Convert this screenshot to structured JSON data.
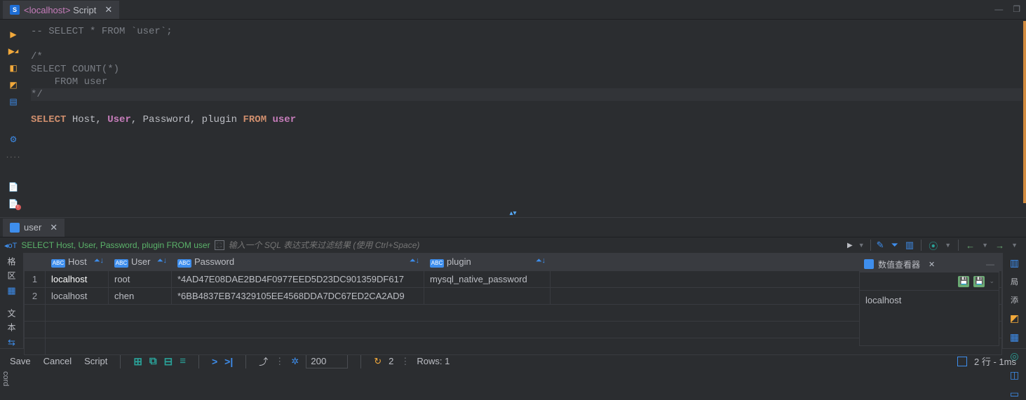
{
  "editor": {
    "tab_title_prefix": "<localhost>",
    "tab_title": "Script",
    "lines": {
      "l1": "-- SELECT * FROM `user`;",
      "l3": "/*",
      "l4_kw": "SELECT",
      "l4_fn": " COUNT(*)",
      "l5_kw": "    FROM",
      "l5_tbl": " user",
      "l6": "*/",
      "l8_kw1": "SELECT",
      "l8_cols1": " Host, ",
      "l8_user": "User",
      "l8_cols2": ", Password, plugin ",
      "l8_kw2": "FROM",
      "l8_tbl": " user"
    }
  },
  "results": {
    "tab_label": "user",
    "query_text": "SELECT Host, User, Password, plugin FROM user",
    "filter_placeholder": "输入一个 SQL 表达式来过滤结果 (使用 Ctrl+Space)",
    "columns": [
      "Host",
      "User",
      "Password",
      "plugin"
    ],
    "rows": [
      {
        "n": "1",
        "Host": "localhost",
        "User": "root",
        "Password": "*4AD47E08DAE2BD4F0977EED5D23DC901359DF617",
        "plugin": "mysql_native_password"
      },
      {
        "n": "2",
        "Host": "localhost",
        "User": "chen",
        "Password": "*6BB4837EB74329105EE4568DDA7DC67ED2CA2AD9",
        "plugin": ""
      }
    ]
  },
  "viewer": {
    "title": "数值查看器",
    "value": "localhost"
  },
  "footer": {
    "save": "Save",
    "cancel": "Cancel",
    "script": "Script",
    "page_size": "200",
    "refresh_count": "2",
    "rows_label": "Rows:",
    "rows_value": "1",
    "status": "2 行 - 1ms"
  },
  "side": {
    "left1": "格",
    "left2": "区",
    "left3": "文",
    "left4": "本",
    "right1": "局",
    "right2": "添",
    "cord": "cord"
  }
}
